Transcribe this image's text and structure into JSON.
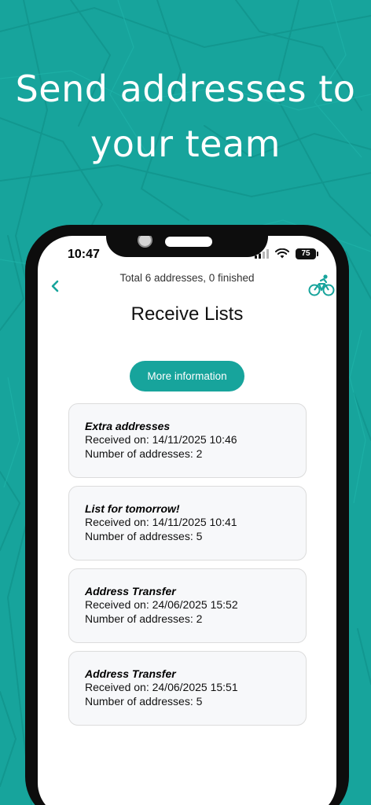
{
  "headline": {
    "line1": "Send addresses to",
    "line2": "your team"
  },
  "status_bar": {
    "time": "10:47",
    "battery": "75",
    "icons": [
      "cellular-signal-icon",
      "wifi-icon",
      "battery-icon"
    ]
  },
  "header": {
    "summary": "Total 6 addresses, 0 finished",
    "title": "Receive Lists",
    "back_icon": "chevron-left-icon",
    "right_icon": "bicycle-icon"
  },
  "more_button": {
    "label": "More information"
  },
  "lists": [
    {
      "title": "Extra addresses",
      "received": "Received on: 14/11/2025 10:46",
      "count": "Number of addresses: 2"
    },
    {
      "title": "List for tomorrow!",
      "received": "Received on: 14/11/2025 10:41",
      "count": "Number of addresses: 5"
    },
    {
      "title": "Address Transfer",
      "received": "Received on: 24/06/2025 15:52",
      "count": "Number of addresses: 2"
    },
    {
      "title": "Address Transfer",
      "received": "Received on: 24/06/2025 15:51",
      "count": "Number of addresses: 5"
    }
  ],
  "colors": {
    "background": "#17a49c",
    "accent": "#17a49c",
    "card_background": "#f7f8fa",
    "card_border": "#dcdcdc"
  }
}
